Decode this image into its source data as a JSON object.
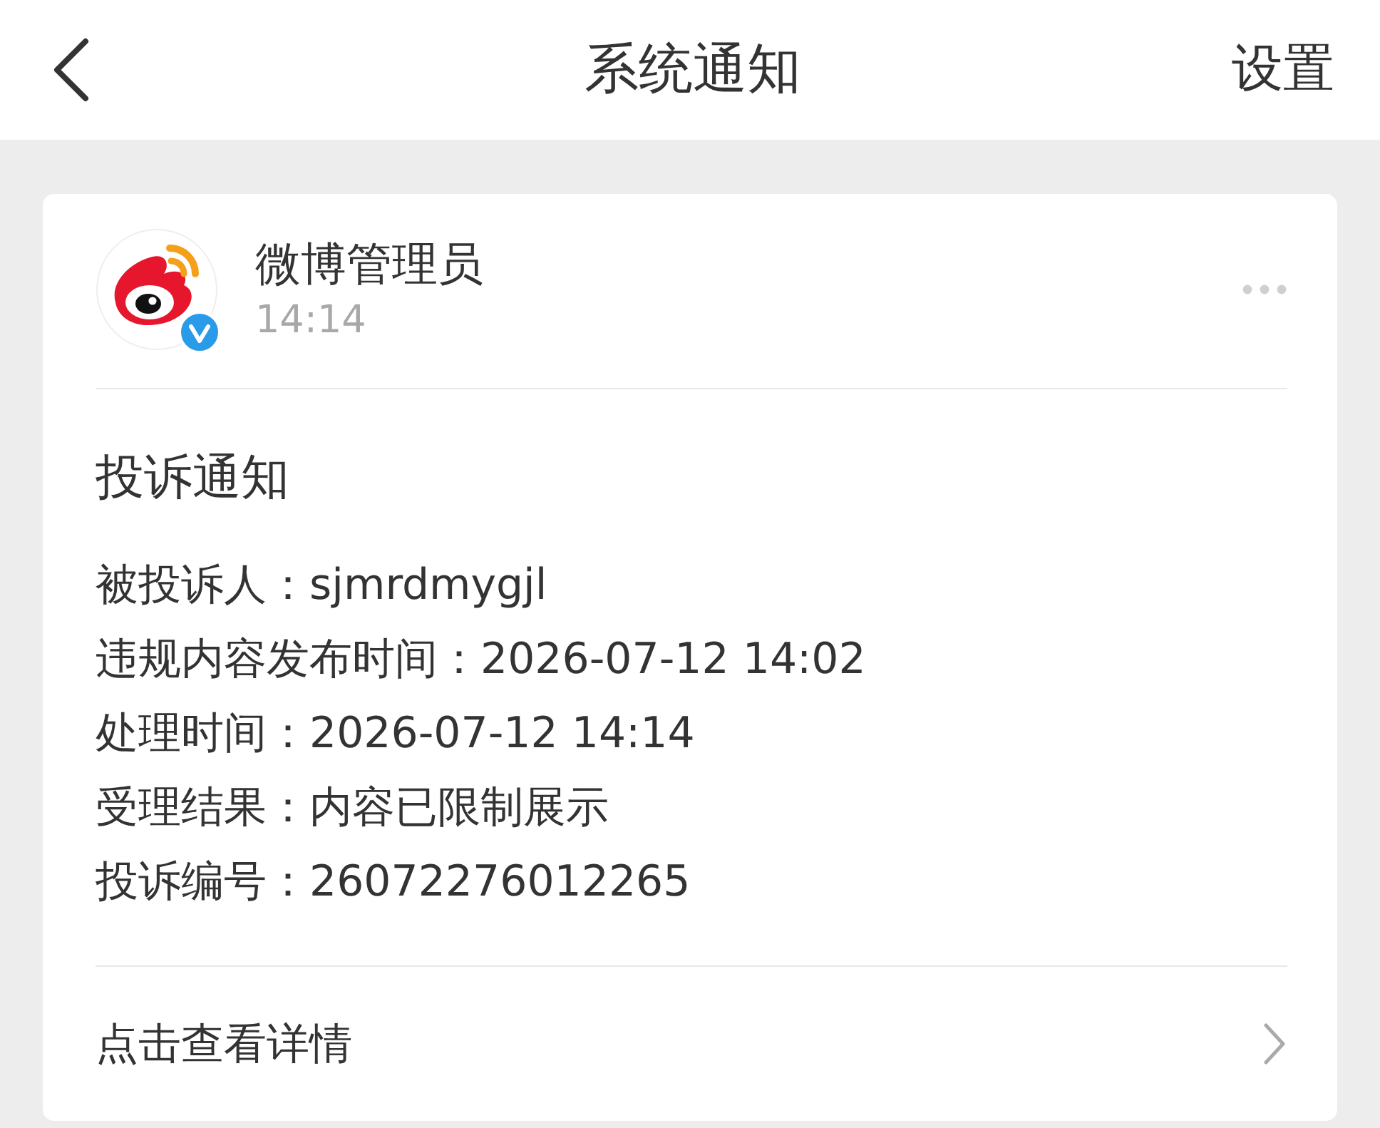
{
  "nav": {
    "title": "系统通知",
    "action": "设置"
  },
  "message": {
    "sender": "微博管理员",
    "time": "14:14",
    "verified": true,
    "title": "投诉通知",
    "fields": [
      {
        "label": "被投诉人：",
        "value": "sjmrdmygjl"
      },
      {
        "label": "违规内容发布时间：",
        "value": "2026-07-12 14:02"
      },
      {
        "label": "处理时间：",
        "value": "2026-07-12 14:14"
      },
      {
        "label": "受理结果：",
        "value": "内容已限制展示"
      },
      {
        "label": "投诉编号：",
        "value": "26072276012265"
      }
    ],
    "link": "点击查看详情"
  }
}
